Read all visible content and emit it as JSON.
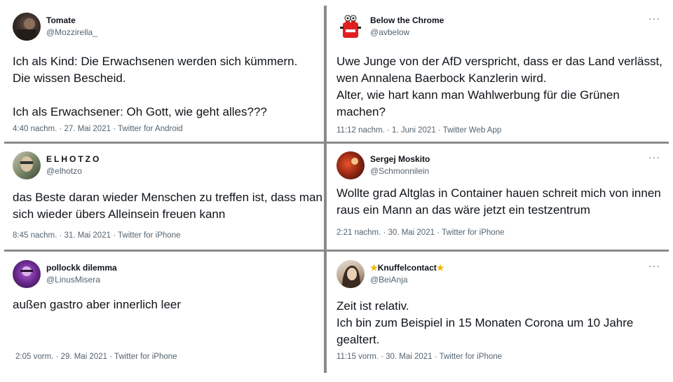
{
  "tweets": [
    {
      "name": "Tomate",
      "handle": "@Mozzirella_",
      "text": "Ich als Kind: Die Erwachsenen werden sich kümmern.\nDie wissen Bescheid.\n\nIch als Erwachsener: Oh Gott, wie geht alles???",
      "meta": "4:40 nachm. · 27. Mai 2021 · Twitter for Android"
    },
    {
      "name": "Below the Chrome",
      "handle": "@avbelow",
      "more": "···",
      "text": "Uwe Junge von der AfD verspricht, dass er das Land verlässt, wen Annalena Baerbock Kanzlerin wird.\nAlter, wie hart kann man Wahlwerbung für die Grünen machen?",
      "meta": "11:12 nachm. · 1. Juni 2021 · Twitter Web App"
    },
    {
      "name": "ELHOTZO",
      "handle": "@elhotzo",
      "text": "das Beste daran wieder Menschen zu treffen ist, dass man sich wieder übers Alleinsein freuen kann",
      "meta": "8:45 nachm. · 31. Mai 2021 · Twitter for iPhone"
    },
    {
      "name": "Sergej Moskito",
      "handle": "@Schmonnilein",
      "more": "···",
      "text": "Wollte grad Altglas in Container hauen schreit mich von innen raus ein Mann an das wäre jetzt ein testzentrum",
      "meta": "2:21 nachm. · 30. Mai 2021 · Twitter for iPhone"
    },
    {
      "name": "pollockk dilemma",
      "handle": "@LinusMisera",
      "text": "außen gastro aber innerlich leer",
      "meta": "2:05 vorm. · 29. Mai 2021 · Twitter for iPhone"
    },
    {
      "name": "Knuffelcontact",
      "name_star": "★",
      "handle": "@BeiAnja",
      "more": "···",
      "text": "Zeit ist relativ.\nIch bin zum Beispiel in 15 Monaten Corona um 10 Jahre gealtert.",
      "meta": "11:15 vorm. · 30. Mai 2021 · Twitter for iPhone"
    }
  ],
  "colors": {
    "text": "#0f1419",
    "secondary": "#536471",
    "divider": "#8a8a8a",
    "star": "#f4b400"
  }
}
